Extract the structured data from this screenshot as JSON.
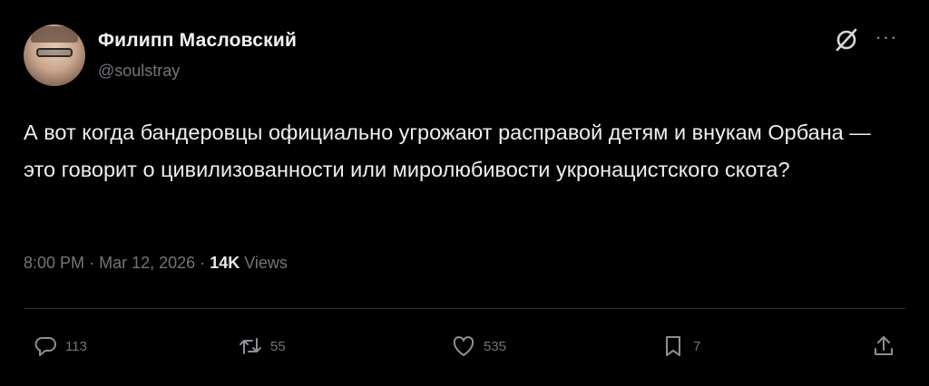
{
  "author": {
    "name": "Филипп Масловский",
    "handle": "@soulstray"
  },
  "tweet": {
    "text": "А вот когда бандеровцы официально угрожают расправой детям и внукам Орбана — это говорит о цивилизованности или миролюбивости укронацистского скота?"
  },
  "meta": {
    "time": "8:00 PM",
    "separator": "·",
    "date": "Mar 12, 2026",
    "views_count": "14K",
    "views_label": "Views"
  },
  "actions": {
    "replies": "113",
    "reposts": "55",
    "likes": "535",
    "bookmarks": "7"
  },
  "icons": {
    "grok": "grok-icon",
    "more": "more-icon",
    "reply": "reply-icon",
    "repost": "repost-icon",
    "like": "heart-icon",
    "bookmark": "bookmark-icon",
    "share": "share-icon"
  },
  "colors": {
    "background": "#000000",
    "text": "#e7e9ea",
    "muted": "#71767b",
    "divider": "#2f3336"
  }
}
